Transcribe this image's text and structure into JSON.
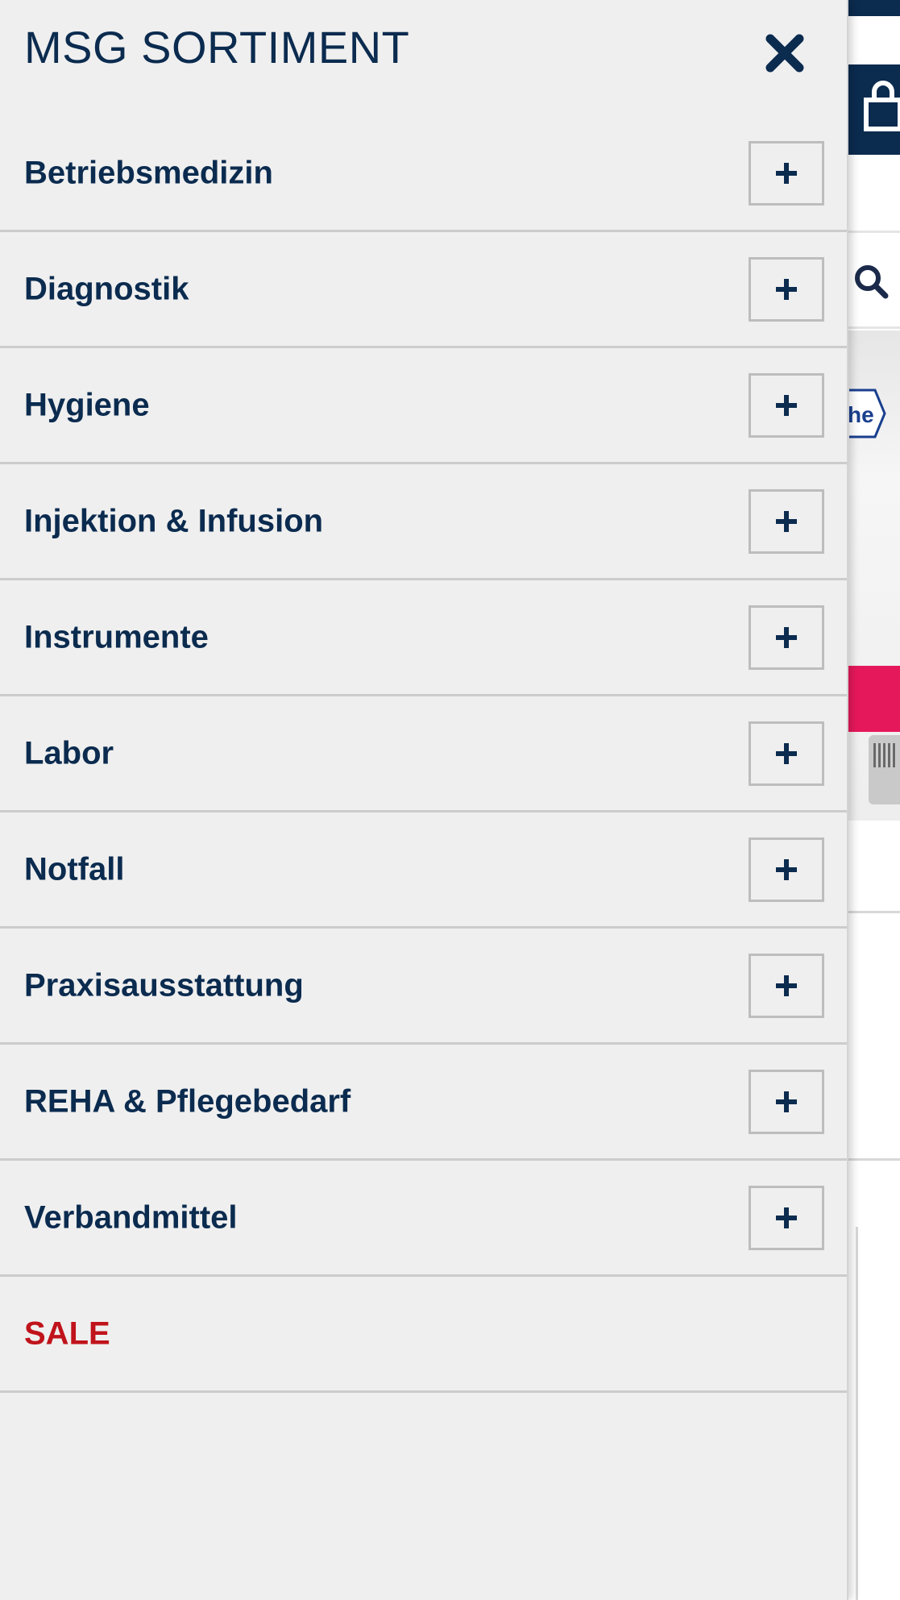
{
  "menu": {
    "title": "MSG SORTIMENT",
    "close_icon": "close-icon",
    "expand_icon": "plus-icon",
    "items": [
      {
        "label": "Betriebsmedizin",
        "expandable": true
      },
      {
        "label": "Diagnostik",
        "expandable": true
      },
      {
        "label": "Hygiene",
        "expandable": true
      },
      {
        "label": "Injektion & Infusion",
        "expandable": true
      },
      {
        "label": "Instrumente",
        "expandable": true
      },
      {
        "label": "Labor",
        "expandable": true
      },
      {
        "label": "Notfall",
        "expandable": true
      },
      {
        "label": "Praxisausstattung",
        "expandable": true
      },
      {
        "label": "REHA & Pflegebedarf",
        "expandable": true
      },
      {
        "label": "Verbandmittel",
        "expandable": true
      },
      {
        "label": "SALE",
        "expandable": false
      }
    ]
  },
  "background": {
    "cart_icon": "shopping-bag-icon",
    "search_icon": "search-icon",
    "partial_logo_text": "he"
  },
  "colors": {
    "primary": "#0b2b4f",
    "sale": "#c0131b",
    "menu_background": "#efefef",
    "divider": "#cccccc",
    "accent_pink": "#e6185c"
  }
}
